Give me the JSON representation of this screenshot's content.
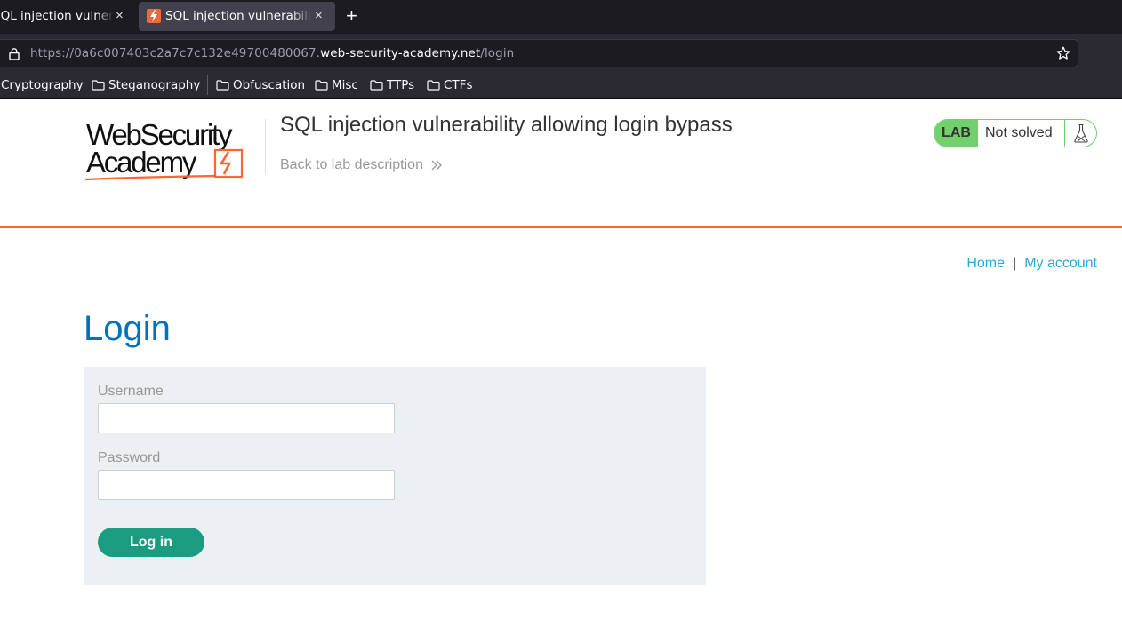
{
  "browser": {
    "tabs": [
      {
        "label": "SQL injection vulnerability allowing login bypass"
      },
      {
        "label": "SQL injection vulnerability allowing login bypass"
      }
    ],
    "new_tab_glyph": "+",
    "close_glyph": "×",
    "url": {
      "prefix": "https://0a6c007403c2a7c7c132e49700480067.",
      "host": "web-security-academy.net",
      "path": "/login"
    },
    "bookmarks": [
      {
        "label": "Cryptography",
        "folder": false
      },
      {
        "label": "Steganography",
        "folder": true
      },
      {
        "label": "Obfuscation",
        "folder": true
      },
      {
        "label": "Misc",
        "folder": true
      },
      {
        "label": "TTPs",
        "folder": true
      },
      {
        "label": "CTFs",
        "folder": true
      }
    ]
  },
  "header": {
    "logo_line1": "WebSecurity",
    "logo_line2": "Academy",
    "lab_title": "SQL injection vulnerability allowing login bypass",
    "back_link": "Back to lab description",
    "lab_tag": "LAB",
    "lab_status": "Not solved"
  },
  "nav": {
    "home": "Home",
    "separator": "|",
    "my_account": "My account"
  },
  "login": {
    "heading": "Login",
    "username_label": "Username",
    "username_value": "",
    "password_label": "Password",
    "password_value": "",
    "submit_label": "Log in"
  },
  "colors": {
    "brand_orange": "#ff6633",
    "heading_blue": "#0071bc",
    "link_blue": "#29a9d9",
    "button_green": "#1a9c80",
    "lab_green": "#70d16d",
    "panel_bg": "#ebf0f2"
  }
}
